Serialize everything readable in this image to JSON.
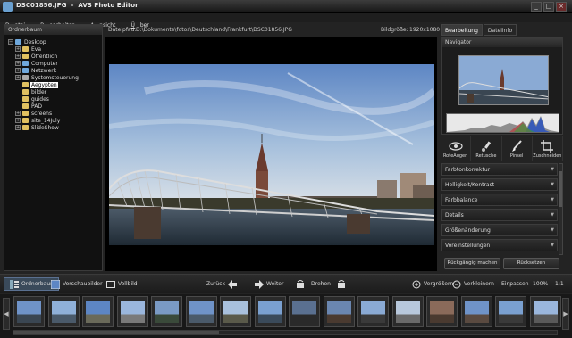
{
  "window": {
    "filename": "DSC01856.JPG",
    "app_name": "AVS Photo Editor",
    "separator": "-"
  },
  "menu": [
    {
      "u": "D",
      "rest": "atei"
    },
    {
      "u": "B",
      "rest": "earbeiten"
    },
    {
      "u": "A",
      "rest": "nsicht"
    },
    {
      "u": "Ü",
      "rest": "ber"
    }
  ],
  "left_panel": {
    "title": "Ordnerbaum",
    "tree": [
      {
        "label": "Desktop",
        "expander": "−",
        "icon": "desktop",
        "level": 0
      },
      {
        "label": "Eva",
        "expander": "+",
        "icon": "folder",
        "level": 1
      },
      {
        "label": "Öffentlich",
        "expander": "+",
        "icon": "folder",
        "level": 1
      },
      {
        "label": "Computer",
        "expander": "+",
        "icon": "computer",
        "level": 1
      },
      {
        "label": "Netzwerk",
        "expander": "+",
        "icon": "network",
        "level": 1
      },
      {
        "label": "Systemsteuerung",
        "expander": "+",
        "icon": "control-panel",
        "level": 1
      },
      {
        "label": "Aegypten",
        "expander": "",
        "icon": "folder",
        "level": 1,
        "selected": true
      },
      {
        "label": "bilder",
        "expander": "",
        "icon": "folder",
        "level": 1
      },
      {
        "label": "guides",
        "expander": "",
        "icon": "folder",
        "level": 1
      },
      {
        "label": "PAD",
        "expander": "",
        "icon": "folder",
        "level": 1
      },
      {
        "label": "screens",
        "expander": "+",
        "icon": "folder",
        "level": 1
      },
      {
        "label": "site_14July",
        "expander": "+",
        "icon": "folder",
        "level": 1
      },
      {
        "label": "SlideShow",
        "expander": "+",
        "icon": "folder",
        "level": 1
      }
    ]
  },
  "info": {
    "path_label": "Dateipfad:",
    "path": "D:\\Dokumente\\fotos\\Deutschland\\Frankfurt\\DSC01856.JPG",
    "size_label": "Bildgröße:",
    "size_value": "1920x1080"
  },
  "right_tabs": [
    {
      "label": "Bearbeitung",
      "active": true
    },
    {
      "label": "Dateiinfo",
      "active": false
    }
  ],
  "navigator": {
    "title": "Navigator"
  },
  "tools": [
    {
      "label": "RoteAugen",
      "icon": "eye-icon"
    },
    {
      "label": "Retusche",
      "icon": "retouch-brush-icon"
    },
    {
      "label": "Pinsel",
      "icon": "paintbrush-icon"
    },
    {
      "label": "Zuschneiden",
      "icon": "crop-icon"
    }
  ],
  "sections": [
    {
      "label": "Farbtonkorrektur"
    },
    {
      "label": "Helligkeit/Kontrast"
    },
    {
      "label": "Farbbalance"
    },
    {
      "label": "Details"
    },
    {
      "label": "Größenänderung"
    },
    {
      "label": "Voreinstellungen"
    }
  ],
  "actions": {
    "undo_all": "Rückgängig machen",
    "reset": "Rücksetzen"
  },
  "toolbar": {
    "folder_tree": "Ordnerbaum",
    "thumbnails": "Vorschaubilder",
    "fullscreen": "Vollbild",
    "back": "Zurück",
    "forward": "Weiter",
    "rotate": "Drehen",
    "zoom_in": "Vergrößern",
    "zoom_out": "Verkleinern",
    "fit": "Einpassen",
    "zoom_value": "100%",
    "ratio": "1:1"
  },
  "colors": {
    "accent": "#5a7090",
    "panel_bg": "#1c1c1c",
    "window_bg": "#232323"
  }
}
